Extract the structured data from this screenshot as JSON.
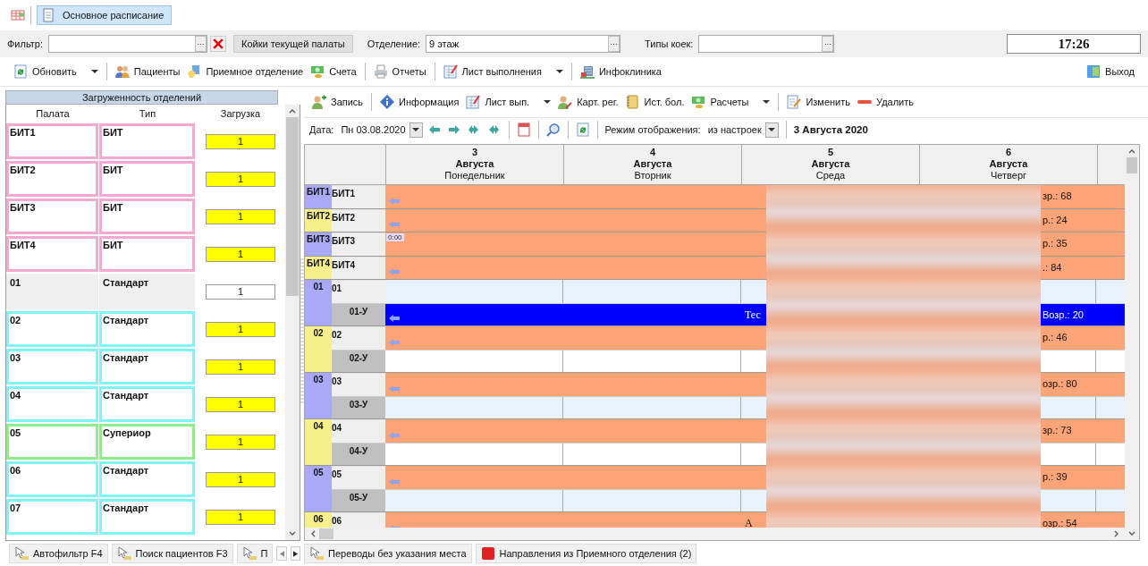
{
  "doc_tabs": [
    {
      "label": "Основное расписание",
      "selected": true
    }
  ],
  "filter_bar": {
    "filter_label": "Фильтр:",
    "current_beds_button": "Койки текущей палаты",
    "department_label": "Отделение:",
    "department_value": "9 этаж",
    "bed_types_label": "Типы коек:",
    "clock": "17:26",
    "ellipsis": "···"
  },
  "main_toolbar": [
    {
      "kind": "button",
      "label": "Обновить",
      "dropdown": true
    },
    {
      "kind": "separator"
    },
    {
      "kind": "button",
      "label": "Пациенты",
      "dropdown": false
    },
    {
      "kind": "button",
      "label": "Приемное отделение",
      "dropdown": false
    },
    {
      "kind": "button",
      "label": "Счета",
      "dropdown": false
    },
    {
      "kind": "separator"
    },
    {
      "kind": "button",
      "label": "Отчеты",
      "dropdown": false
    },
    {
      "kind": "separator"
    },
    {
      "kind": "button",
      "label": "Лист выполнения",
      "dropdown": true
    },
    {
      "kind": "separator"
    },
    {
      "kind": "button",
      "label": "Инфоклиника",
      "dropdown": false
    }
  ],
  "exit_button": "Выход",
  "load_panel": {
    "title": "Загруженность отделений",
    "columns": [
      "Палата",
      "Тип",
      "Загрузка"
    ],
    "rows": [
      {
        "room": "БИТ1",
        "type": "БИТ",
        "load": "1",
        "color": "#f7a8cf",
        "selected": false,
        "highlighted": true
      },
      {
        "room": "БИТ2",
        "type": "БИТ",
        "load": "1",
        "color": "#f7a8cf",
        "selected": false,
        "highlighted": true
      },
      {
        "room": "БИТ3",
        "type": "БИТ",
        "load": "1",
        "color": "#f7a8cf",
        "selected": false,
        "highlighted": true
      },
      {
        "room": "БИТ4",
        "type": "БИТ",
        "load": "1",
        "color": "#f7a8cf",
        "selected": false,
        "highlighted": true
      },
      {
        "room": "01",
        "type": "Стандарт",
        "load": "1",
        "selected": true,
        "highlighted": false
      },
      {
        "room": "02",
        "type": "Стандарт",
        "load": "1",
        "color": "#7ff5f5",
        "selected": false,
        "highlighted": true
      },
      {
        "room": "03",
        "type": "Стандарт",
        "load": "1",
        "color": "#7ff5f5",
        "selected": false,
        "highlighted": true
      },
      {
        "room": "04",
        "type": "Стандарт",
        "load": "1",
        "color": "#7ff5f5",
        "selected": false,
        "highlighted": true
      },
      {
        "room": "05",
        "type": "Супериор",
        "load": "1",
        "color": "#8cef8c",
        "selected": false,
        "highlighted": true
      },
      {
        "room": "06",
        "type": "Стандарт",
        "load": "1",
        "color": "#7ff5f5",
        "selected": false,
        "highlighted": true
      },
      {
        "room": "07",
        "type": "Стандарт",
        "load": "1",
        "color": "#7ff5f5",
        "selected": false,
        "highlighted": true
      }
    ]
  },
  "schedule_toolbar": [
    {
      "kind": "button",
      "label": "Запись",
      "dropdown": false
    },
    {
      "kind": "separator"
    },
    {
      "kind": "button",
      "label": "Информация",
      "dropdown": false
    },
    {
      "kind": "button",
      "label": "Лист вып.",
      "dropdown": true
    },
    {
      "kind": "button",
      "label": "Карт. рег.",
      "dropdown": false
    },
    {
      "kind": "button",
      "label": "Ист. бол.",
      "dropdown": false
    },
    {
      "kind": "button",
      "label": "Расчеты",
      "dropdown": true
    },
    {
      "kind": "separator"
    },
    {
      "kind": "button",
      "label": "Изменить",
      "dropdown": false
    },
    {
      "kind": "button",
      "label": "Удалить",
      "dropdown": false
    }
  ],
  "date_bar": {
    "date_label": "Дата:",
    "date_value": "Пн 03.08.2020",
    "mode_label": "Режим отображения:",
    "mode_value": "из настроек",
    "current_date": "3 Августа 2020"
  },
  "schedule": {
    "days": [
      {
        "day": "3",
        "month": "Августа",
        "weekday": "Понедельник"
      },
      {
        "day": "4",
        "month": "Августа",
        "weekday": "Вторник"
      },
      {
        "day": "5",
        "month": "Августа",
        "weekday": "Среда"
      },
      {
        "day": "6",
        "month": "Августа",
        "weekday": "Четверг"
      }
    ],
    "groups": [
      {
        "label": "БИТ1",
        "color": "#a9a9f7",
        "beds": [
          {
            "label": "БИТ1",
            "kind": "main",
            "lane": {
              "kind": "bar",
              "color": "#fca377",
              "arrow": true,
              "text_end": "зр.: 68"
            }
          }
        ]
      },
      {
        "label": "БИТ2",
        "color": "#f7f08a",
        "beds": [
          {
            "label": "БИТ2",
            "kind": "main",
            "lane": {
              "kind": "bar",
              "color": "#fca377",
              "arrow": true,
              "text_end": "р.: 24"
            }
          }
        ]
      },
      {
        "label": "БИТ3",
        "color": "#a9a9f7",
        "beds": [
          {
            "label": "БИТ3",
            "kind": "main",
            "lane": {
              "kind": "bar",
              "color": "#fca377",
              "arrow": false,
              "time": "0:00",
              "text_end": "р.: 35"
            }
          }
        ]
      },
      {
        "label": "БИТ4",
        "color": "#f7f08a",
        "beds": [
          {
            "label": "БИТ4",
            "kind": "main",
            "lane": {
              "kind": "bar",
              "color": "#fca377",
              "arrow": true,
              "text_end": ".: 84"
            }
          }
        ]
      },
      {
        "label": "01",
        "color": "#a9a9f7",
        "beds": [
          {
            "label": "01",
            "kind": "main",
            "lane": {
              "kind": "empty",
              "color": "#e8f2fd"
            }
          },
          {
            "label": "01-У",
            "kind": "extra",
            "lane": {
              "kind": "bar",
              "color": "#0000ff",
              "arrow": true,
              "text_start": "Тес",
              "text_end": "Возр.: 20"
            }
          }
        ]
      },
      {
        "label": "02",
        "color": "#f7f08a",
        "beds": [
          {
            "label": "02",
            "kind": "main",
            "lane": {
              "kind": "bar",
              "color": "#fca377",
              "arrow": true,
              "text_end": "р.: 46"
            }
          },
          {
            "label": "02-У",
            "kind": "extra",
            "lane": {
              "kind": "empty",
              "color": "#ffffff"
            }
          }
        ]
      },
      {
        "label": "03",
        "color": "#a9a9f7",
        "beds": [
          {
            "label": "03",
            "kind": "main",
            "lane": {
              "kind": "bar",
              "color": "#fca377",
              "arrow": true,
              "text_end": "озр.: 80"
            }
          },
          {
            "label": "03-У",
            "kind": "extra",
            "lane": {
              "kind": "empty",
              "color": "#e8f2fd"
            }
          }
        ]
      },
      {
        "label": "04",
        "color": "#f7f08a",
        "beds": [
          {
            "label": "04",
            "kind": "main",
            "lane": {
              "kind": "bar",
              "color": "#fca377",
              "arrow": true,
              "text_end": "зр.: 73"
            }
          },
          {
            "label": "04-У",
            "kind": "extra",
            "lane": {
              "kind": "empty",
              "color": "#ffffff"
            }
          }
        ]
      },
      {
        "label": "05",
        "color": "#a9a9f7",
        "beds": [
          {
            "label": "05",
            "kind": "main",
            "lane": {
              "kind": "bar",
              "color": "#fca377",
              "arrow": true,
              "text_end": "р.: 39"
            }
          },
          {
            "label": "05-У",
            "kind": "extra",
            "lane": {
              "kind": "empty",
              "color": "#e8f2fd"
            }
          }
        ]
      },
      {
        "label": "06",
        "color": "#f7f08a",
        "beds": [
          {
            "label": "06",
            "kind": "main",
            "lane": {
              "kind": "bar",
              "color": "#fca377",
              "arrow": true,
              "text_start": "А",
              "text_end": "озр.: 54"
            }
          }
        ]
      }
    ]
  },
  "left_bottom_tabs": [
    {
      "label": "Автофильтр F4",
      "selected": false
    },
    {
      "label": "Поиск пациентов F3",
      "selected": false
    },
    {
      "label": "П",
      "selected": false
    }
  ],
  "right_bottom_tabs": [
    {
      "label": "Переводы без указания места",
      "kind": "pointer",
      "selected": false
    },
    {
      "label": "Направления из Приемного отделения (2)",
      "kind": "alert",
      "selected": false
    }
  ]
}
